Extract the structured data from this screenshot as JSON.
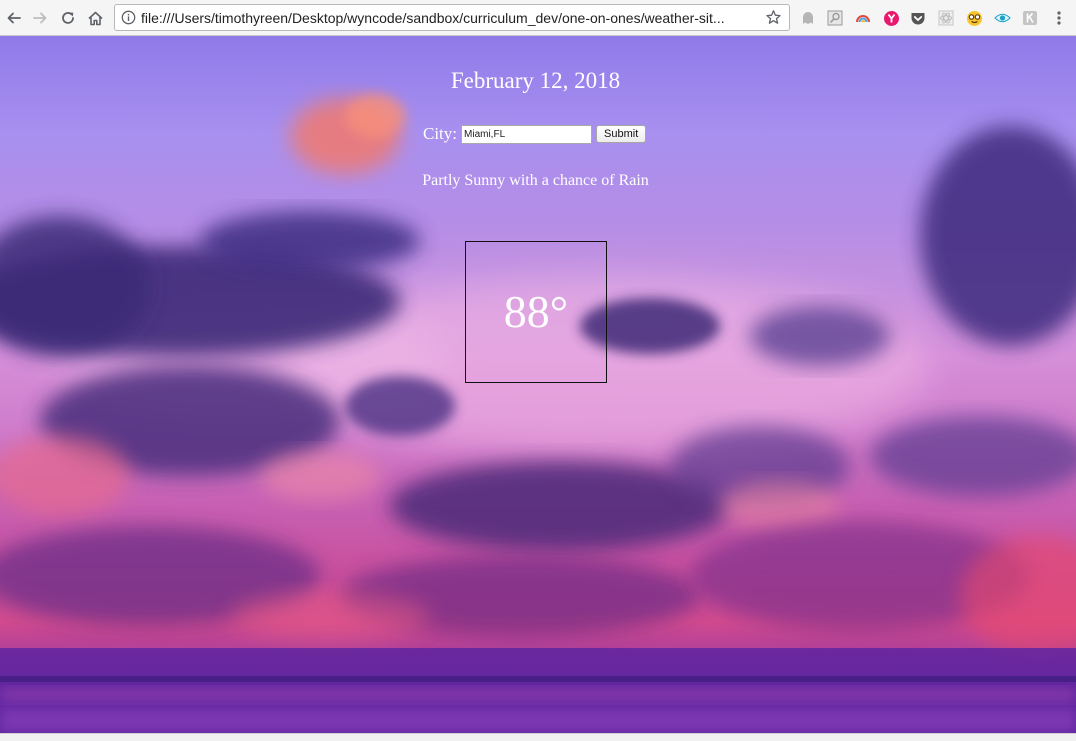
{
  "browser": {
    "url": "file:///Users/timothyreen/Desktop/wyncode/sandbox/curriculum_dev/one-on-ones/weather-sit...",
    "extensions": [
      {
        "name": "ghost-extension-icon",
        "color": "#b5b5b5"
      },
      {
        "name": "search-extension-icon",
        "color": "#9a9a9a"
      },
      {
        "name": "rainbow-extension-icon",
        "color": "#4aa3df"
      },
      {
        "name": "pink-y-extension-icon",
        "color": "#e8186d"
      },
      {
        "name": "pocket-extension-icon",
        "color": "#555555"
      },
      {
        "name": "react-extension-icon",
        "color": "#bdbdbd"
      },
      {
        "name": "nerd-emoji-extension-icon",
        "color": "#f7c52b"
      },
      {
        "name": "eye-extension-icon",
        "color": "#1aa3c8"
      },
      {
        "name": "k-extension-icon",
        "color": "#b0b0b0"
      }
    ]
  },
  "page": {
    "date": "February 12, 2018",
    "city_label": "City:",
    "city_value": "Miami,FL",
    "submit_label": "Submit",
    "conditions": "Partly Sunny with a chance of Rain",
    "temperature": "88°"
  },
  "colors": {
    "text": "#ffffff",
    "temp_border": "#111111"
  }
}
